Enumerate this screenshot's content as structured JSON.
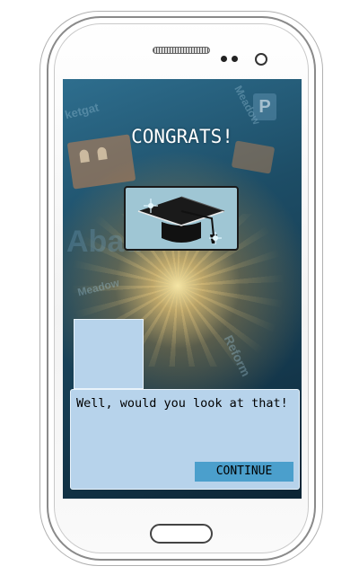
{
  "device": {
    "type": "smartphone",
    "icons": [
      "speaker-icon",
      "camera-icon",
      "home-button-icon"
    ]
  },
  "screen": {
    "title": "CONGRATS!",
    "badge": {
      "icon": "graduation-cap-icon",
      "background_color": "#9fc6d4"
    },
    "background_map_words": [
      "ketgat",
      "Meadow",
      "Abad",
      "Meadow",
      "Reform"
    ],
    "map_sign": "P",
    "portrait": {
      "background_color": "#b7d3eb"
    },
    "dialog": {
      "text": "Well, would you look at that!",
      "continue_label": "CONTINUE",
      "background_color": "#b7d3eb",
      "button_color": "#4b9fcc"
    }
  }
}
